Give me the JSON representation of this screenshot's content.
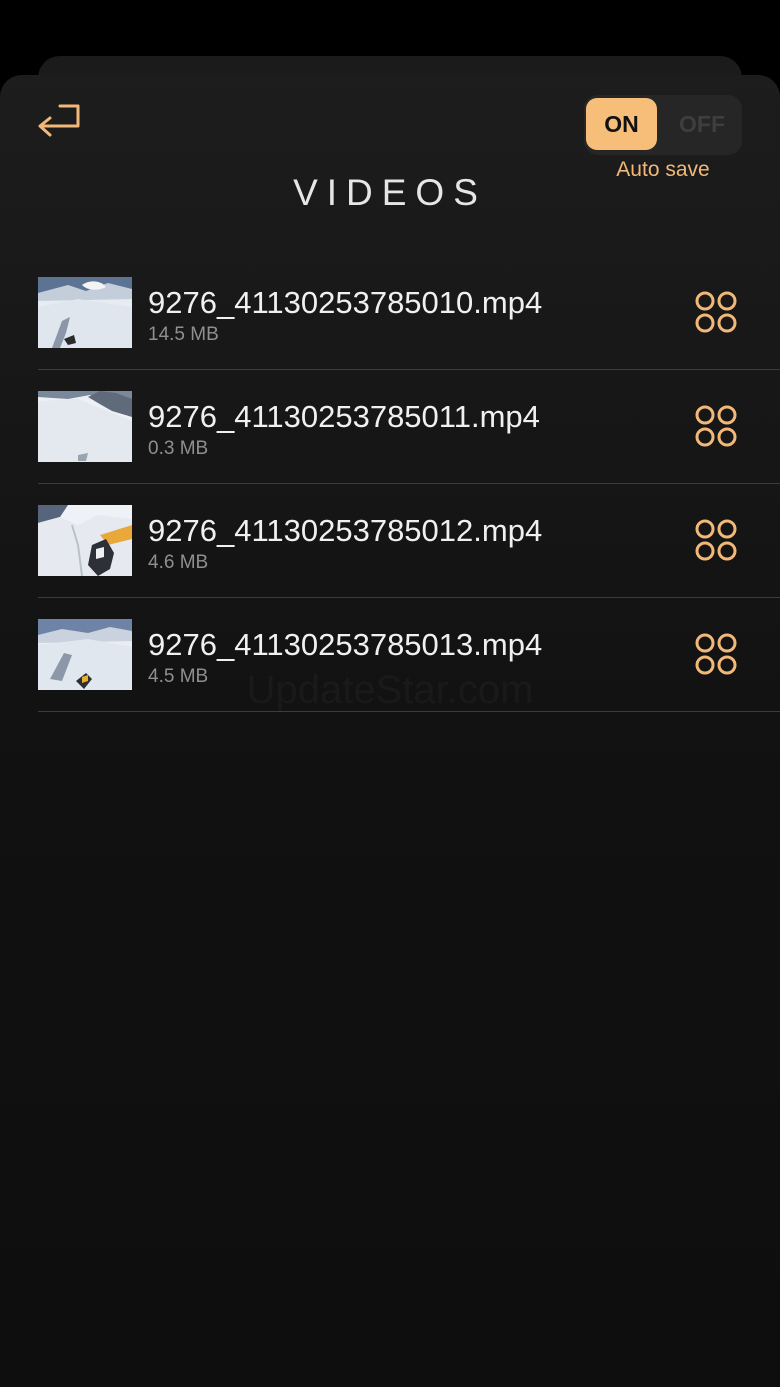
{
  "header": {
    "title": "VIDEOS",
    "back_icon": "return-arrow-icon"
  },
  "autosave": {
    "on_label": "ON",
    "off_label": "OFF",
    "label": "Auto save",
    "state": "on",
    "accent_color": "#f7be7a"
  },
  "videos": [
    {
      "name": "9276_41130253785010.mp4",
      "size": "14.5 MB",
      "thumb": "snow-slope-shadow"
    },
    {
      "name": "9276_41130253785011.mp4",
      "size": "0.3 MB",
      "thumb": "snow-slope-wide"
    },
    {
      "name": "9276_41130253785012.mp4",
      "size": "4.6 MB",
      "thumb": "snow-arm-yellow-jacket"
    },
    {
      "name": "9276_41130253785013.mp4",
      "size": "4.5 MB",
      "thumb": "snow-skier-shadow"
    }
  ],
  "row_menu_icon": "four-circles-icon",
  "watermark": "UpdateStar.com"
}
